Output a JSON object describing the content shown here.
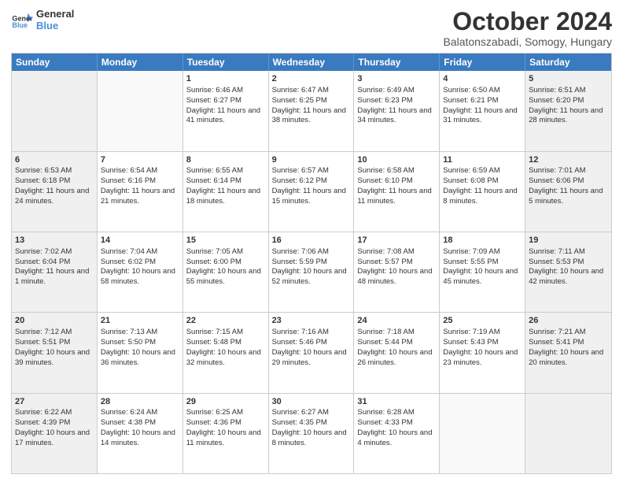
{
  "logo": {
    "general": "General",
    "blue": "Blue"
  },
  "title": "October 2024",
  "subtitle": "Balatonszabadi, Somogy, Hungary",
  "header_days": [
    "Sunday",
    "Monday",
    "Tuesday",
    "Wednesday",
    "Thursday",
    "Friday",
    "Saturday"
  ],
  "rows": [
    [
      {
        "day": "",
        "sunrise": "",
        "sunset": "",
        "daylight": "",
        "empty": true
      },
      {
        "day": "",
        "sunrise": "",
        "sunset": "",
        "daylight": "",
        "empty": true
      },
      {
        "day": "1",
        "sunrise": "Sunrise: 6:46 AM",
        "sunset": "Sunset: 6:27 PM",
        "daylight": "Daylight: 11 hours and 41 minutes."
      },
      {
        "day": "2",
        "sunrise": "Sunrise: 6:47 AM",
        "sunset": "Sunset: 6:25 PM",
        "daylight": "Daylight: 11 hours and 38 minutes."
      },
      {
        "day": "3",
        "sunrise": "Sunrise: 6:49 AM",
        "sunset": "Sunset: 6:23 PM",
        "daylight": "Daylight: 11 hours and 34 minutes."
      },
      {
        "day": "4",
        "sunrise": "Sunrise: 6:50 AM",
        "sunset": "Sunset: 6:21 PM",
        "daylight": "Daylight: 11 hours and 31 minutes."
      },
      {
        "day": "5",
        "sunrise": "Sunrise: 6:51 AM",
        "sunset": "Sunset: 6:20 PM",
        "daylight": "Daylight: 11 hours and 28 minutes."
      }
    ],
    [
      {
        "day": "6",
        "sunrise": "Sunrise: 6:53 AM",
        "sunset": "Sunset: 6:18 PM",
        "daylight": "Daylight: 11 hours and 24 minutes."
      },
      {
        "day": "7",
        "sunrise": "Sunrise: 6:54 AM",
        "sunset": "Sunset: 6:16 PM",
        "daylight": "Daylight: 11 hours and 21 minutes."
      },
      {
        "day": "8",
        "sunrise": "Sunrise: 6:55 AM",
        "sunset": "Sunset: 6:14 PM",
        "daylight": "Daylight: 11 hours and 18 minutes."
      },
      {
        "day": "9",
        "sunrise": "Sunrise: 6:57 AM",
        "sunset": "Sunset: 6:12 PM",
        "daylight": "Daylight: 11 hours and 15 minutes."
      },
      {
        "day": "10",
        "sunrise": "Sunrise: 6:58 AM",
        "sunset": "Sunset: 6:10 PM",
        "daylight": "Daylight: 11 hours and 11 minutes."
      },
      {
        "day": "11",
        "sunrise": "Sunrise: 6:59 AM",
        "sunset": "Sunset: 6:08 PM",
        "daylight": "Daylight: 11 hours and 8 minutes."
      },
      {
        "day": "12",
        "sunrise": "Sunrise: 7:01 AM",
        "sunset": "Sunset: 6:06 PM",
        "daylight": "Daylight: 11 hours and 5 minutes."
      }
    ],
    [
      {
        "day": "13",
        "sunrise": "Sunrise: 7:02 AM",
        "sunset": "Sunset: 6:04 PM",
        "daylight": "Daylight: 11 hours and 1 minute."
      },
      {
        "day": "14",
        "sunrise": "Sunrise: 7:04 AM",
        "sunset": "Sunset: 6:02 PM",
        "daylight": "Daylight: 10 hours and 58 minutes."
      },
      {
        "day": "15",
        "sunrise": "Sunrise: 7:05 AM",
        "sunset": "Sunset: 6:00 PM",
        "daylight": "Daylight: 10 hours and 55 minutes."
      },
      {
        "day": "16",
        "sunrise": "Sunrise: 7:06 AM",
        "sunset": "Sunset: 5:59 PM",
        "daylight": "Daylight: 10 hours and 52 minutes."
      },
      {
        "day": "17",
        "sunrise": "Sunrise: 7:08 AM",
        "sunset": "Sunset: 5:57 PM",
        "daylight": "Daylight: 10 hours and 48 minutes."
      },
      {
        "day": "18",
        "sunrise": "Sunrise: 7:09 AM",
        "sunset": "Sunset: 5:55 PM",
        "daylight": "Daylight: 10 hours and 45 minutes."
      },
      {
        "day": "19",
        "sunrise": "Sunrise: 7:11 AM",
        "sunset": "Sunset: 5:53 PM",
        "daylight": "Daylight: 10 hours and 42 minutes."
      }
    ],
    [
      {
        "day": "20",
        "sunrise": "Sunrise: 7:12 AM",
        "sunset": "Sunset: 5:51 PM",
        "daylight": "Daylight: 10 hours and 39 minutes."
      },
      {
        "day": "21",
        "sunrise": "Sunrise: 7:13 AM",
        "sunset": "Sunset: 5:50 PM",
        "daylight": "Daylight: 10 hours and 36 minutes."
      },
      {
        "day": "22",
        "sunrise": "Sunrise: 7:15 AM",
        "sunset": "Sunset: 5:48 PM",
        "daylight": "Daylight: 10 hours and 32 minutes."
      },
      {
        "day": "23",
        "sunrise": "Sunrise: 7:16 AM",
        "sunset": "Sunset: 5:46 PM",
        "daylight": "Daylight: 10 hours and 29 minutes."
      },
      {
        "day": "24",
        "sunrise": "Sunrise: 7:18 AM",
        "sunset": "Sunset: 5:44 PM",
        "daylight": "Daylight: 10 hours and 26 minutes."
      },
      {
        "day": "25",
        "sunrise": "Sunrise: 7:19 AM",
        "sunset": "Sunset: 5:43 PM",
        "daylight": "Daylight: 10 hours and 23 minutes."
      },
      {
        "day": "26",
        "sunrise": "Sunrise: 7:21 AM",
        "sunset": "Sunset: 5:41 PM",
        "daylight": "Daylight: 10 hours and 20 minutes."
      }
    ],
    [
      {
        "day": "27",
        "sunrise": "Sunrise: 6:22 AM",
        "sunset": "Sunset: 4:39 PM",
        "daylight": "Daylight: 10 hours and 17 minutes."
      },
      {
        "day": "28",
        "sunrise": "Sunrise: 6:24 AM",
        "sunset": "Sunset: 4:38 PM",
        "daylight": "Daylight: 10 hours and 14 minutes."
      },
      {
        "day": "29",
        "sunrise": "Sunrise: 6:25 AM",
        "sunset": "Sunset: 4:36 PM",
        "daylight": "Daylight: 10 hours and 11 minutes."
      },
      {
        "day": "30",
        "sunrise": "Sunrise: 6:27 AM",
        "sunset": "Sunset: 4:35 PM",
        "daylight": "Daylight: 10 hours and 8 minutes."
      },
      {
        "day": "31",
        "sunrise": "Sunrise: 6:28 AM",
        "sunset": "Sunset: 4:33 PM",
        "daylight": "Daylight: 10 hours and 4 minutes."
      },
      {
        "day": "",
        "sunrise": "",
        "sunset": "",
        "daylight": "",
        "empty": true
      },
      {
        "day": "",
        "sunrise": "",
        "sunset": "",
        "daylight": "",
        "empty": true
      }
    ]
  ]
}
